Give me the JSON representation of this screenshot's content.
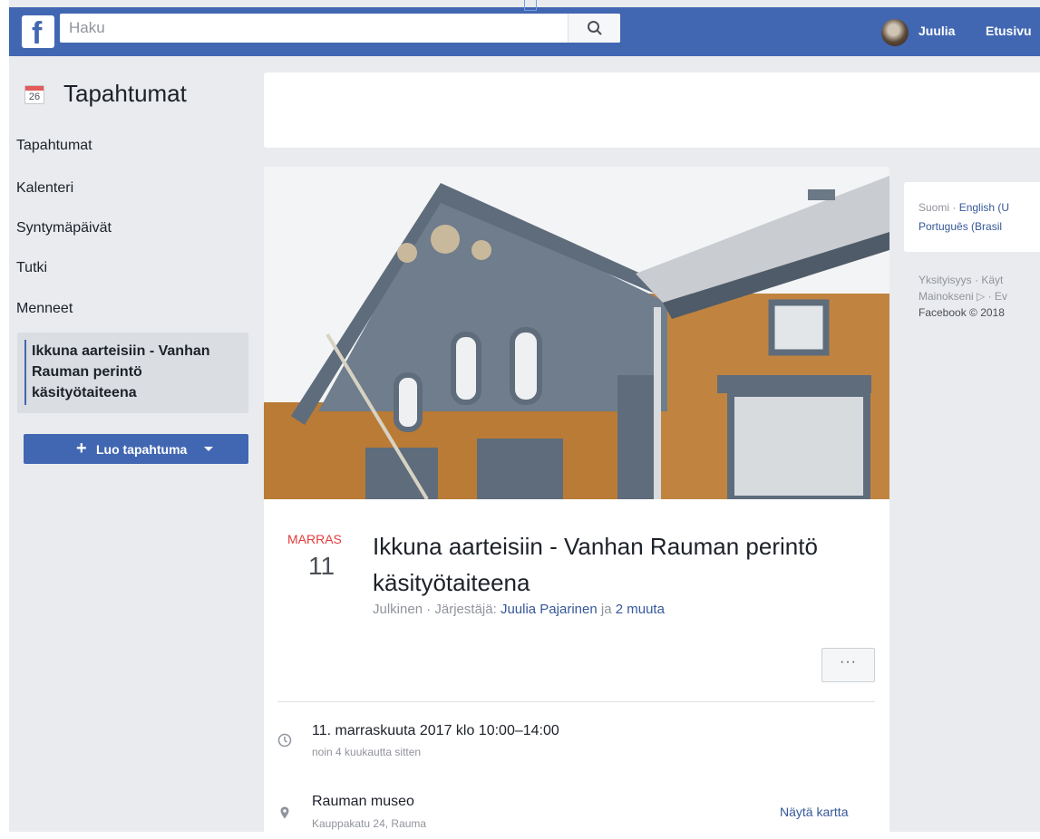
{
  "topbar": {
    "search_placeholder": "Haku",
    "logo_letter": "f",
    "user_name": "Juulia",
    "home_label": "Etusivu"
  },
  "sidebar": {
    "calendar_day": "26",
    "title": "Tapahtumat",
    "items": [
      {
        "label": "Tapahtumat"
      },
      {
        "label": "Kalenteri"
      },
      {
        "label": "Syntymäpäivät"
      },
      {
        "label": "Tutki"
      },
      {
        "label": "Menneet"
      }
    ],
    "active_event": "Ikkuna aarteisiin - Vanhan Rauman perintö käsityötaiteena",
    "create_button": "Luo tapahtuma",
    "create_plus": "+"
  },
  "event": {
    "month": "MARRAS",
    "day": "11",
    "title": "Ikkuna aarteisiin - Vanhan Rauman perintö käsityötaiteena",
    "visibility": "Julkinen",
    "organizer_prefix": "Järjestäjä:",
    "organizer": "Juulia Pajarinen",
    "conjunction": "ja",
    "others": "2 muuta",
    "more_label": "···",
    "time_main": "11. marraskuuta 2017 klo 10:00–14:00",
    "time_sub": "noin 4 kuukautta sitten",
    "place_main": "Rauman museo",
    "place_sub": "Kauppakatu 24, Rauma",
    "map_link": "Näytä kartta"
  },
  "right": {
    "lang_current": "Suomi",
    "lang_english": "English (U",
    "lang_portuguese": "Português (Brasil",
    "footer_line1": "Yksityisyys · Käyt",
    "footer_line2": "Mainokseni ▷ · Ev",
    "copyright": "Facebook © 2018"
  },
  "icons": {
    "search": "search-icon",
    "calendar": "calendar-icon",
    "clock": "clock-icon",
    "location": "location-pin-icon",
    "caret": "caret-down-icon"
  },
  "colors": {
    "brand_blue": "#4267b2",
    "link_blue": "#365899",
    "month_red": "#e23b3b",
    "page_bg": "#e9ebee"
  }
}
